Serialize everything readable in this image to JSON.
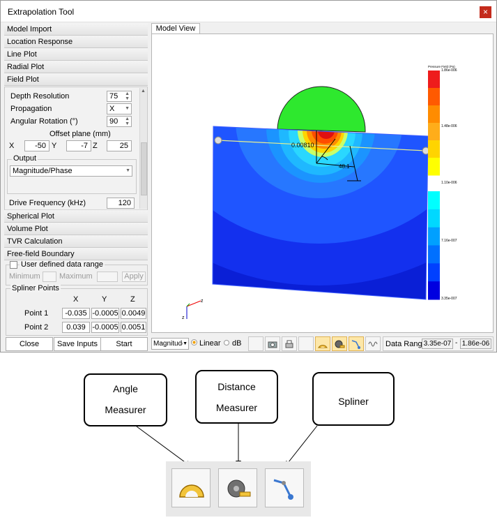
{
  "window": {
    "title": "Extrapolation Tool",
    "close_glyph": "×"
  },
  "sections": {
    "model_import": "Model Import",
    "location_response": "Location Response",
    "line_plot": "Line Plot",
    "radial_plot": "Radial Plot",
    "field_plot": "Field Plot",
    "spherical_plot": "Spherical Plot",
    "volume_plot": "Volume Plot",
    "tvr_calculation": "TVR Calculation",
    "free_field_boundary": "Free-field Boundary"
  },
  "field_plot": {
    "depth_resolution_label": "Depth Resolution",
    "depth_resolution_value": "75",
    "propagation_label": "Propagation",
    "propagation_value": "X",
    "angular_rotation_label": "Angular Rotation (°)",
    "angular_rotation_value": "90",
    "offset_plane_label": "Offset plane (mm)",
    "x_label": "X",
    "x_value": "-50",
    "y_label": "Y",
    "y_value": "-7",
    "z_label": "Z",
    "z_value": "25",
    "output_label": "Output",
    "output_value": "Magnitude/Phase",
    "drive_frequency_label": "Drive Frequency (kHz)",
    "drive_frequency_value": "120"
  },
  "free_field": {
    "user_range_label": "User defined data range",
    "minimum_label": "Minimum",
    "maximum_label": "Maximum",
    "apply_label": "Apply"
  },
  "spliner_points": {
    "title": "Spliner Points",
    "columns": [
      "X",
      "Y",
      "Z"
    ],
    "rows": [
      {
        "label": "Point 1",
        "values": [
          "-0.035",
          "-0.0005",
          "0.0049"
        ]
      },
      {
        "label": "Point 2",
        "values": [
          "0.039",
          "-0.0005",
          "0.0051"
        ]
      }
    ]
  },
  "buttons": {
    "close": "Close",
    "save_inputs": "Save Inputs",
    "start": "Start"
  },
  "model_view": {
    "tab_label": "Model View",
    "measure_text_1": "0.00810",
    "measure_text_2": "48.1",
    "axis_x": "z",
    "axis_y": "z"
  },
  "colorbar": {
    "title": "Pressure Field (Pa)",
    "labels": [
      "1.86e-006",
      "1.48e-006",
      "1.10e-006",
      "7.16e-007",
      "3.35e-007"
    ],
    "colors": [
      "#ee1c1c",
      "#ff5a00",
      "#ff8c00",
      "#ffad1a",
      "#ffd400",
      "#ffff00",
      "#00ffff",
      "#00d8ff",
      "#00a0ff",
      "#0070ff",
      "#0040ff",
      "#0000e0"
    ]
  },
  "toolbar": {
    "mode_value": "Magnitude",
    "linear_label": "Linear",
    "db_label": "dB",
    "data_range_label": "Data Range",
    "range_min": "3.35e-07",
    "range_sep": "-",
    "range_max": "1.86e-06"
  },
  "callouts": {
    "angle_1": "Angle",
    "angle_2": "Measurer",
    "distance_1": "Distance",
    "distance_2": "Measurer",
    "spliner": "Spliner"
  },
  "icons": {
    "angle": "angle-measurer-icon",
    "distance": "distance-measurer-icon",
    "spliner": "spliner-icon"
  }
}
